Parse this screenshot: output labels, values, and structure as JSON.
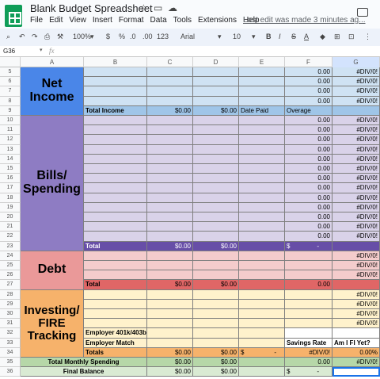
{
  "app": {
    "title": "Blank Budget Spreadsheet",
    "last_edit": "Last edit was made 3 minutes ag..."
  },
  "menu": [
    "File",
    "Edit",
    "View",
    "Insert",
    "Format",
    "Data",
    "Tools",
    "Extensions",
    "Help"
  ],
  "toolbar": {
    "zoom": "100%",
    "currency": "$",
    "percent": "%",
    "decrease_decimal": ".0",
    "increase_decimal": ".00",
    "format_more": "123",
    "font": "Arial",
    "font_size": "10",
    "bold": "B",
    "italic": "I",
    "strike": "S",
    "text_color": "A"
  },
  "namebox": "G36",
  "fx": "fx",
  "columns": [
    "A",
    "B",
    "C",
    "D",
    "E",
    "F",
    "G"
  ],
  "rows": [
    "5",
    "6",
    "7",
    "8",
    "9",
    "10",
    "11",
    "12",
    "13",
    "14",
    "15",
    "16",
    "17",
    "18",
    "19",
    "20",
    "21",
    "22",
    "23",
    "24",
    "25",
    "26",
    "27",
    "28",
    "29",
    "30",
    "31",
    "32",
    "33",
    "34",
    "35",
    "36"
  ],
  "sections": {
    "net_income": "Net Income",
    "bills": "Bills/ Spending",
    "debt": "Debt",
    "investing": "Investing/ FIRE Tracking"
  },
  "labels": {
    "total_income": "Total Income",
    "date_paid": "Date Paid",
    "overage": "Overage",
    "total": "Total",
    "employer_401k": "Employer 401k/403b",
    "employer_match": "Employer Match",
    "totals": "Totals",
    "savings_rate": "Savings Rate",
    "am_i_fi": "Am I FI Yet?",
    "total_monthly_spending": "Total Monthly Spending",
    "final_balance": "Final Balance"
  },
  "values": {
    "zero": "0.00",
    "div0": "#DIV/0!",
    "usd_zero": "$0.00",
    "dollar": "$",
    "dash": "-",
    "zero_pct": "0.00%"
  },
  "colors": {
    "net_income": "#4a86e8",
    "income_rows": "#cfe2f3",
    "income_total": "#9fc5e8",
    "bills": "#8e7cc3",
    "bills_rows": "#d9d2e9",
    "bills_total": "#674ea7",
    "debt": "#ea9999",
    "debt_rows": "#f4cccc",
    "debt_total": "#e06666",
    "investing": "#f6b26b",
    "investing_rows": "#fff2cc",
    "green": "#b6d7a8",
    "light_green": "#d9ead3"
  }
}
